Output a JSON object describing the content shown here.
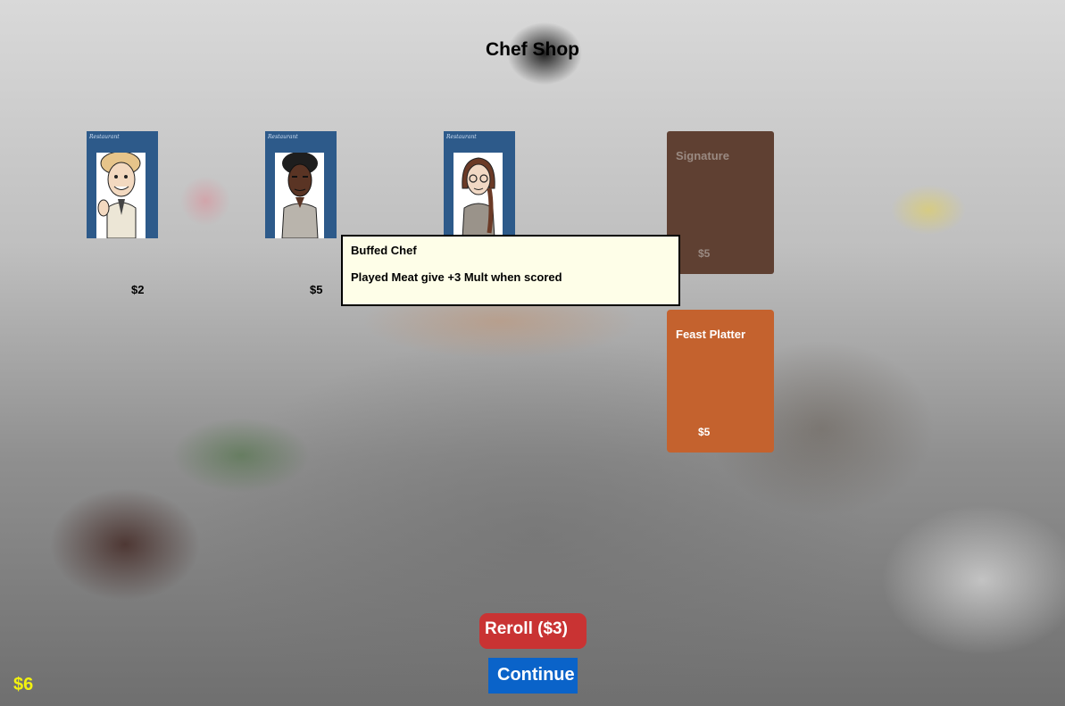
{
  "shop": {
    "title": "Chef Shop",
    "money": "$6"
  },
  "chefs": [
    {
      "portrait": "curly-haired-chef-waving",
      "brand": "Restaurant",
      "price": "$2"
    },
    {
      "portrait": "dark-haired-chef",
      "brand": "Restaurant",
      "price": "$5"
    },
    {
      "portrait": "chef-with-glasses-braid",
      "brand": "Restaurant"
    }
  ],
  "specials": [
    {
      "name": "Signature",
      "price": "$5",
      "color": "#5f4032"
    },
    {
      "name": "Feast Platter",
      "price": "$5",
      "color": "#c4622e"
    }
  ],
  "tooltip": {
    "title": "Buffed Chef",
    "description": "Played Meat give +3 Mult when scored"
  },
  "buttons": {
    "reroll": "Reroll ($3)",
    "continue": "Continue"
  },
  "colors": {
    "chef_card": "#2d5a8a",
    "reroll": "#c93333",
    "continue": "#0a63c9",
    "money": "#f2f20f"
  }
}
